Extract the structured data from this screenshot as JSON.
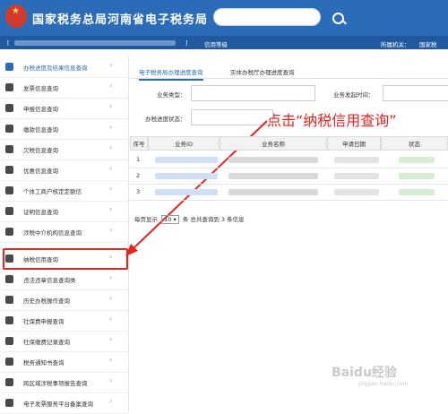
{
  "header": {
    "title": "国家税务总局河南省电子税务局",
    "search_placeholder": ""
  },
  "infobar": {
    "bracket_left": "[",
    "bracket_right": "]",
    "credit_label": "信用等级",
    "authority_label": "所属机关：",
    "authority_value": "国家税"
  },
  "sidebar": {
    "items": [
      {
        "label": "办税进度及结果信息查询",
        "icon": "clipboard-icon",
        "active": true
      },
      {
        "label": "发票信息查询",
        "icon": "invoice-icon"
      },
      {
        "label": "申报信息查询",
        "icon": "report-icon"
      },
      {
        "label": "缴款信息查询",
        "icon": "payment-icon"
      },
      {
        "label": "欠税信息查询",
        "icon": "owed-tax-icon"
      },
      {
        "label": "优惠信息查询",
        "icon": "discount-icon"
      },
      {
        "label": "个体工商户核定定额信",
        "icon": "merchant-icon"
      },
      {
        "label": "证明信息查询",
        "icon": "certificate-icon"
      },
      {
        "label": "涉税中介机构信息查询",
        "icon": "agency-icon"
      },
      {
        "label": "纳税信用查询",
        "icon": "credit-icon"
      },
      {
        "label": "违法违章信息查询类",
        "icon": "violation-icon"
      },
      {
        "label": "历史办税操作查询",
        "icon": "history-icon"
      },
      {
        "label": "社保费申报查询",
        "icon": "social-security-icon"
      },
      {
        "label": "社保缴费记录查询",
        "icon": "payment-record-icon"
      },
      {
        "label": "税务通知书查询",
        "icon": "notice-icon"
      },
      {
        "label": "跨区域涉税事项报告查询",
        "icon": "cross-region-icon"
      },
      {
        "label": "电子发票服务平台备案查询",
        "icon": "e-invoice-icon"
      }
    ]
  },
  "tabs": [
    {
      "label": "电子税务局办理进度查询",
      "active": true
    },
    {
      "label": "实体办税厅办理进度查询",
      "active": false
    }
  ],
  "form": {
    "business_type_label": "业务类型：",
    "start_time_label": "业务发起时间：",
    "status_label": "办税进度状态："
  },
  "callout": "点击“纳税信用查询”",
  "table": {
    "headers": [
      "序号",
      "业务ID",
      "业务名称",
      "申请日期",
      "状态"
    ],
    "rows": [
      "1",
      "2",
      "3"
    ]
  },
  "pager": {
    "prefix": "每页显示",
    "page_size": "10",
    "suffix": "条 总共查询到 3 条信息"
  },
  "watermark": {
    "main": "Baidu经验",
    "sub": "jingyan.baidu.com"
  }
}
